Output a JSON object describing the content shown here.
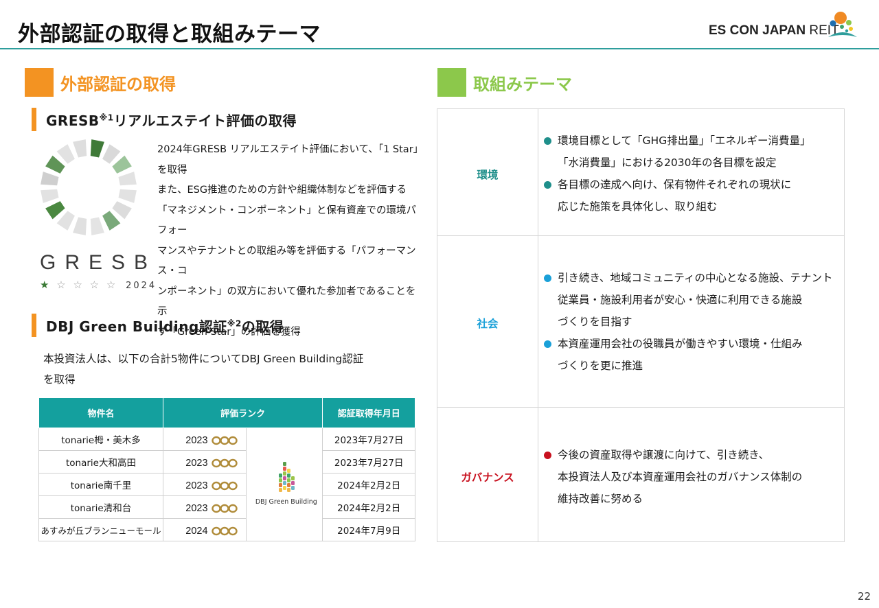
{
  "header": {
    "title": "外部認証の取得と取組みテーマ",
    "brand_bold": "ES CON JAPAN",
    "brand_light": " REIT"
  },
  "left": {
    "section_title": "外部認証の取得",
    "gresb": {
      "heading_main": "GRESB",
      "heading_sup": "※1",
      "heading_rest": "リアルエステイト評価の取得",
      "logo_word": "GRESB",
      "logo_stars_on": "★",
      "logo_stars_off": "☆ ☆ ☆ ☆",
      "logo_year": "2024",
      "lines": [
        "2024年GRESB リアルエステイト評価において、「1 Star」",
        "を取得",
        "また、ESG推進のための方針や組織体制などを評価する",
        "「マネジメント・コンポーネント」と保有資産での環境パフォー",
        "マンスやテナントとの取組み等を評価する「パフォーマンス・コ",
        "ンポーネント」の双方において優れた参加者であることを示",
        "す「Green Star」の評価を獲得"
      ]
    },
    "dbj": {
      "heading_main": "DBJ Green Building認証",
      "heading_sup": "※2",
      "heading_rest": "の取得",
      "lines": [
        "本投資法人は、以下の合計5物件についてDBJ Green Building認証",
        "を取得"
      ],
      "table": {
        "headers": [
          "物件名",
          "評価ランク",
          "認証取得年月日"
        ],
        "logo_label": "DBJ Green Building",
        "rows": [
          {
            "name": "tonarie栂・美木多",
            "year": "2023",
            "date": "2023年7月27日"
          },
          {
            "name": "tonarie大和高田",
            "year": "2023",
            "date": "2023年7月27日"
          },
          {
            "name": "tonarie南千里",
            "year": "2023",
            "date": "2024年2月2日"
          },
          {
            "name": "tonarie清和台",
            "year": "2023",
            "date": "2024年2月2日"
          },
          {
            "name": "あすみが丘ブランニューモール",
            "year": "2024",
            "date": "2024年7月9日"
          }
        ]
      }
    }
  },
  "right": {
    "section_title": "取組みテーマ",
    "themes": [
      {
        "category": "環境",
        "color": "#1f8f8b",
        "items": [
          [
            "環境目標として「GHG排出量」「エネルギー消費量」",
            "「水消費量」における2030年の各目標を設定"
          ],
          [
            "各目標の達成へ向け、保有物件それぞれの現状に",
            "応じた施策を具体化し、取り組む"
          ]
        ]
      },
      {
        "category": "社会",
        "color": "#1aa0d8",
        "items": [
          [
            "引き続き、地域コミュニティの中心となる施設、テナント",
            "従業員・施設利用者が安心・快適に利用できる施設",
            "づくりを目指す"
          ],
          [
            "本資産運用会社の役職員が働きやすい環境・仕組み",
            "づくりを更に推進"
          ]
        ]
      },
      {
        "category": "ガバナンス",
        "color": "#c8101e",
        "items": [
          [
            "今後の資産取得や譲渡に向けて、引き続き、",
            "本投資法人及び本資産運用会社のガバナンス体制の",
            "維持改善に努める"
          ]
        ]
      }
    ]
  },
  "page_number": "22"
}
